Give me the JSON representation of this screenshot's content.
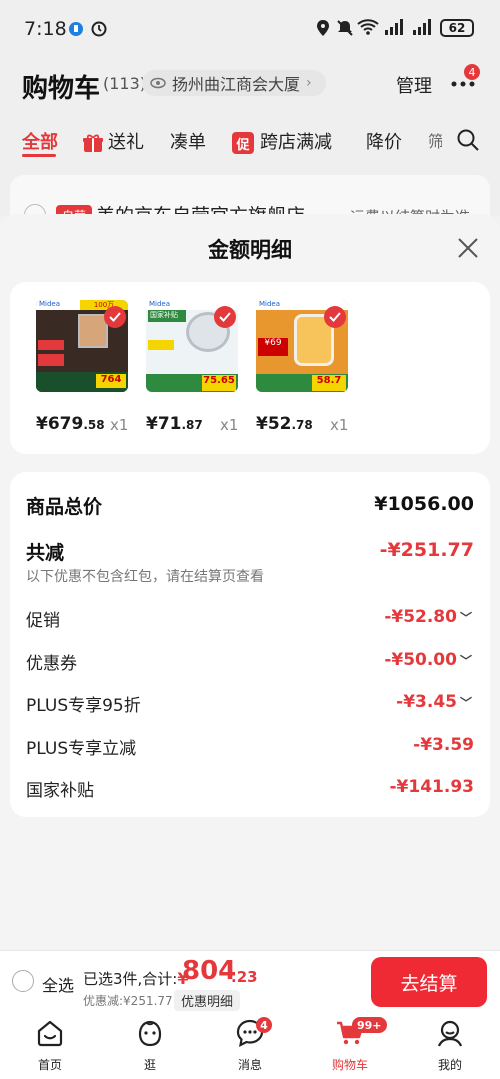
{
  "status_bar": {
    "time": "7:18",
    "battery": "62"
  },
  "header": {
    "title": "购物车",
    "count": "(113)",
    "address": "扬州曲江商会大厦",
    "manage": "管理",
    "more_badge": "4"
  },
  "tabs": [
    {
      "label": "全部"
    },
    {
      "label": "送礼"
    },
    {
      "label": "凑单"
    },
    {
      "label": "跨店满减",
      "tag": "促"
    },
    {
      "label": "降价"
    },
    {
      "label": "筛"
    }
  ],
  "background_store": {
    "tag": "自营",
    "name": "美的京东自营官方旗舰店",
    "right_text": "运费以结算时为准"
  },
  "sheet": {
    "title": "金额明细",
    "products": [
      {
        "price_int": "¥679",
        "price_dec": ".58",
        "qty": "x1",
        "badge": "100万",
        "promo": "764"
      },
      {
        "price_int": "¥71",
        "price_dec": ".87",
        "qty": "x1",
        "badge": "国家补贴",
        "promo": "75.65"
      },
      {
        "price_int": "¥52",
        "price_dec": ".78",
        "qty": "x1",
        "badge": "国家补贴",
        "promo": "58.7"
      }
    ],
    "summary": {
      "total_label": "商品总价",
      "total_value": "¥1056.00",
      "reduce_label": "共减",
      "reduce_value": "-¥251.77",
      "reduce_note": "以下优惠不包含红包，请在结算页查看",
      "lines": [
        {
          "label": "促销",
          "value": "-¥52.80",
          "expandable": true
        },
        {
          "label": "优惠券",
          "value": "-¥50.00",
          "expandable": true
        },
        {
          "label": "PLUS专享95折",
          "value": "-¥3.45",
          "expandable": true
        },
        {
          "label": "PLUS专享立减",
          "value": "-¥3.59",
          "expandable": false
        },
        {
          "label": "国家补贴",
          "value": "-¥141.93",
          "expandable": false
        }
      ]
    }
  },
  "bottom_bar": {
    "select_all": "全选",
    "selected_info": "已选3件,合计:",
    "currency": "¥",
    "total_int": "804",
    "total_dec": ".23",
    "discount": "优惠减:¥251.77",
    "detail_button": "优惠明细",
    "checkout": "去结算"
  },
  "nav": [
    {
      "label": "首页",
      "icon": "home-icon"
    },
    {
      "label": "逛",
      "icon": "browse-icon"
    },
    {
      "label": "消息",
      "icon": "message-icon",
      "badge": "4"
    },
    {
      "label": "购物车",
      "icon": "cart-icon",
      "badge": "99+",
      "active": true
    },
    {
      "label": "我的",
      "icon": "profile-icon"
    }
  ],
  "colors": {
    "accent": "#e4393c",
    "checkout": "#f02a35"
  }
}
